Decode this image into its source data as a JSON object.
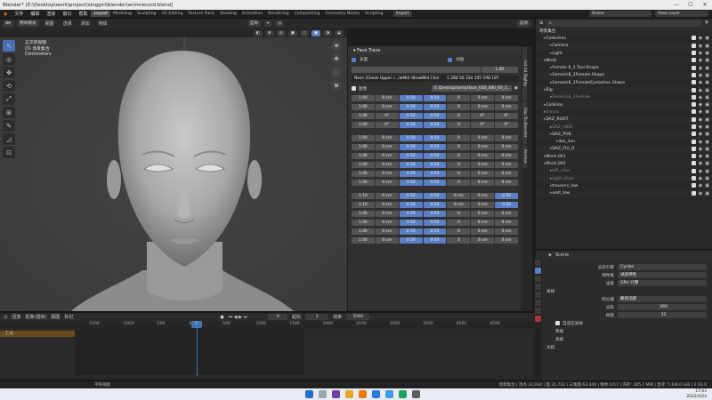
{
  "window": {
    "title": "Blender* [E:\\Desktop\\work\\project\\singgirl\\blender\\animrecord.blend]",
    "controls": [
      "—",
      "☐",
      "✕"
    ]
  },
  "topbar": {
    "menus": [
      "文件",
      "编辑",
      "渲染",
      "窗口",
      "帮助"
    ],
    "workspaces": [
      "Layout",
      "Modeling",
      "Sculpting",
      "UV Editing",
      "Texture Paint",
      "Shading",
      "Animation",
      "Rendering",
      "Compositing",
      "Geometry Nodes",
      "Scripting"
    ],
    "active_workspace": "Layout",
    "import_label": "Import",
    "scene_label": "Scene",
    "viewlayer_label": "View Layer"
  },
  "viewport_header": {
    "mode": "物体模式",
    "menus": [
      "视图",
      "选择",
      "添加",
      "物体"
    ],
    "transform": "全局",
    "options": "选项"
  },
  "viewport_info": {
    "line1": "正交前视图",
    "line2": "(0) 场景集合",
    "line3": "Centimeters"
  },
  "nav": [
    "⊕",
    "✥",
    "🎥",
    "⊞"
  ],
  "tools": [
    "↖",
    "◎",
    "✥",
    "⟲",
    "⤢",
    "⊞",
    "✎",
    "◿",
    "⊡"
  ],
  "npanel": {
    "title": "Face Trace",
    "cb1": "表面",
    "cb2": "视图",
    "slider_value": "1.00",
    "row_path": "Nose /Cheek Upper r.../wMid rBrowMid Chin",
    "row_nums": "1 280 50 334 105 198 187",
    "file_label": "图像",
    "file_path": "E:\\Desktop\\temp\\face_640_480_60_1...",
    "rows": [
      [
        "1.00",
        "0 cm",
        "0.50",
        "0.50",
        "0",
        "0 cm",
        "0 cm"
      ],
      [
        "1.00",
        "0 cm",
        "0.50",
        "0.50",
        "0",
        "0 cm",
        "0 cm"
      ],
      [
        "1.00",
        "0°",
        "0.50",
        "0.50",
        "0",
        "0°",
        "0°"
      ],
      [
        "1.00",
        "0°",
        "0.50",
        "0.50",
        "0",
        "0°",
        "0°"
      ],
      [
        "1.00",
        "0 cm",
        "0.50",
        "0.50",
        "0",
        "0 cm",
        "0 cm"
      ],
      [
        "1.00",
        "0 cm",
        "0.50",
        "0.50",
        "0",
        "0 cm",
        "0 cm"
      ],
      [
        "1.00",
        "0 cm",
        "0.50",
        "0.50",
        "0",
        "0 cm",
        "0 cm"
      ],
      [
        "1.00",
        "0 cm",
        "0.50",
        "0.50",
        "0",
        "0 cm",
        "0 cm"
      ],
      [
        "1.00",
        "0 cm",
        "0.50",
        "0.50",
        "0",
        "0 cm",
        "0 cm"
      ],
      [
        "1.00",
        "0 cm",
        "0.50",
        "0.50",
        "0",
        "0 cm",
        "0 cm"
      ],
      [
        "1.10",
        "0 cm",
        "0.50",
        "0.50",
        "0 cm",
        "0 cm",
        "0.50"
      ],
      [
        "1.10",
        "0 cm",
        "0.50",
        "0.50",
        "0 cm",
        "0 cm",
        "0.50"
      ],
      [
        "1.00",
        "0 cm",
        "0.50",
        "0.50",
        "0",
        "0 cm",
        "0 cm"
      ],
      [
        "1.00",
        "0 cm",
        "0.50",
        "0.50",
        "0",
        "0 cm",
        "0 cm"
      ],
      [
        "1.00",
        "0 cm",
        "0.50",
        "0.50",
        "0",
        "0 cm",
        "0 cm"
      ],
      [
        "1.00",
        "0 cm",
        "0.50",
        "0.50",
        "0",
        "0 cm",
        "0 cm"
      ]
    ],
    "tabs": [
      "View",
      "Anchor",
      "Daz To Blender",
      "Ud 3d Bighty"
    ]
  },
  "outliner": {
    "title": "场景集合",
    "search_placeholder": "",
    "items": [
      {
        "name": "Collection",
        "indent": 1,
        "color": "#ddd"
      },
      {
        "name": "Camera",
        "indent": 2,
        "color": "#ddd"
      },
      {
        "name": "Light",
        "indent": 2,
        "color": "#ddd"
      },
      {
        "name": "Mesh",
        "indent": 1,
        "color": "#ddd"
      },
      {
        "name": "Female 8_1 Tool.Shape",
        "indent": 2,
        "color": "#ddd"
      },
      {
        "name": "Genesis8_1Female.Shape",
        "indent": 2,
        "color": "#ddd"
      },
      {
        "name": "Genesis8_1FemaleEyelashes.Shape",
        "indent": 2,
        "color": "#ddd"
      },
      {
        "name": "Rig",
        "indent": 1,
        "color": "#ddd"
      },
      {
        "name": "Genesis8_1Female",
        "indent": 2,
        "color": "#888"
      },
      {
        "name": "Collision",
        "indent": 1,
        "color": "#ddd"
      },
      {
        "name": "Extras",
        "indent": 1,
        "color": "#888"
      },
      {
        "name": "DAZ_ROOT",
        "indent": 1,
        "color": "#ddd"
      },
      {
        "name": "DAZ_HIDE",
        "indent": 2,
        "color": "#888"
      },
      {
        "name": "DAZ_PUB",
        "indent": 2,
        "color": "#ddd"
      },
      {
        "name": "daz_sun",
        "indent": 3,
        "color": "#ddd"
      },
      {
        "name": "DAZ_FIG_0",
        "indent": 2,
        "color": "#ddd"
      },
      {
        "name": "Mesh.001",
        "indent": 1,
        "color": "#ddd"
      },
      {
        "name": "Mesh.002",
        "indent": 1,
        "color": "#ddd"
      },
      {
        "name": "left_shoe",
        "indent": 2,
        "color": "#888"
      },
      {
        "name": "right_shoe",
        "indent": 2,
        "color": "#888"
      },
      {
        "name": "trousers_low",
        "indent": 2,
        "color": "#ddd"
      },
      {
        "name": "vest_low",
        "indent": 2,
        "color": "#ddd"
      }
    ]
  },
  "properties": {
    "scene": "Scene",
    "render_engine_label": "渲染引擎",
    "render_engine": "Cycles",
    "feature_set_label": "特性集",
    "feature_set": "试验特性",
    "device_label": "设备",
    "device": "GPU 计算",
    "section_sampling": "采样",
    "integrator_label": "积分器",
    "integrator": "路径追踪",
    "render_label": "渲染",
    "render_val": "260",
    "viewport_label": "视图",
    "viewport_val": "32",
    "adaptive": "自适应采样",
    "denoise": "降噪",
    "advanced": "高级",
    "light_paths": "光程"
  },
  "timeline": {
    "menus": [
      "回放",
      "抠像(插帧)",
      "视图",
      "标记"
    ],
    "frame_current": "0",
    "start_label": "起始",
    "start": "1",
    "end_label": "结束",
    "end": "3560",
    "ticks": [
      "1500",
      "-1000",
      "-500",
      "0",
      "500",
      "1000",
      "1500",
      "2000",
      "2500",
      "3000",
      "3500",
      "4000",
      "4500"
    ],
    "channel": "汇总"
  },
  "status": {
    "left": "平移视图",
    "right": "场景集合 | 顶点 32,934 | 面 31,722 | 三角面 63,446 | 物体 0/17 | 内存: 285.7 MiB | 显存: 5.6/8.0 GiB | 2.93.0"
  },
  "taskbar": {
    "time": "17:03",
    "date": "2022/4/24"
  }
}
